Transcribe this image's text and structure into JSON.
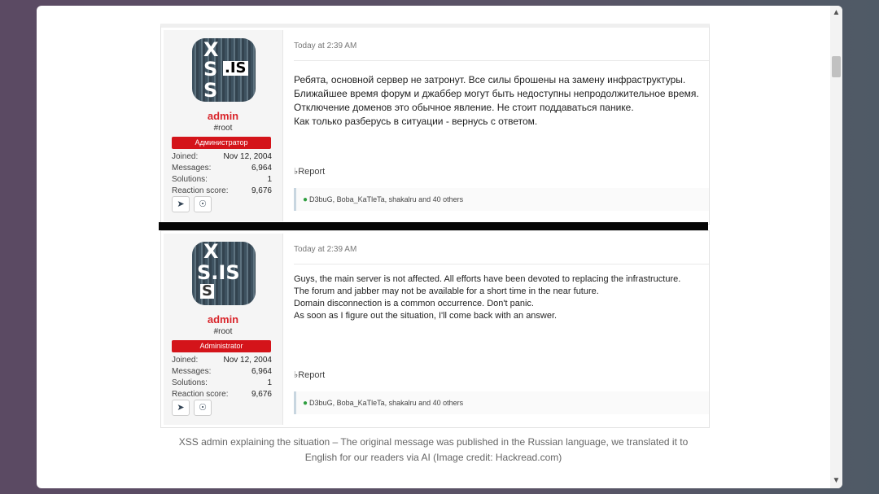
{
  "posts": [
    {
      "avatar_text": {
        "x": "X",
        "s1": "S",
        "is": ".IS",
        "s2": "S"
      },
      "username": "admin",
      "user_title": "#root",
      "role": "Администратор",
      "stats": [
        {
          "label": "Joined:",
          "value": "Nov 12, 2004"
        },
        {
          "label": "Messages:",
          "value": "6,964"
        },
        {
          "label": "Solutions:",
          "value": "1"
        },
        {
          "label": "Reaction score:",
          "value": "9,676"
        }
      ],
      "timestamp": "Today at 2:39 AM",
      "lines": [
        "Ребята, основной сервер не затронут. Все силы брошены на замену инфраструктуры.",
        "Ближайшее время форум и джаббер могут быть недоступны непродолжительное время.",
        "Отключение доменов это обычное явление. Не стоит поддаваться панике.",
        "Как только разберусь в ситуации - вернусь с ответом."
      ],
      "report_label": "Report",
      "reactions_text": "D3buG, Boba_KaTleTa, shakalru and 40 others"
    },
    {
      "avatar_text": {
        "x": "X",
        "sis": "S.IS",
        "s3": "S"
      },
      "username": "admin",
      "user_title": "#root",
      "role": "Administrator",
      "stats": [
        {
          "label": "Joined:",
          "value": "Nov 12, 2004"
        },
        {
          "label": "Messages:",
          "value": "6,964"
        },
        {
          "label": "Solutions:",
          "value": "1"
        },
        {
          "label": "Reaction score:",
          "value": "9,676"
        }
      ],
      "timestamp": "Today at 2:39 AM",
      "lines": [
        "Guys, the main server is not affected. All efforts have been devoted to replacing the infrastructure.",
        "The forum and jabber may not be available for a short time in the near future.",
        "Domain disconnection is a common occurrence. Don't panic.",
        "As soon as I figure out the situation, I'll come back with an answer."
      ],
      "report_label": "Report",
      "reactions_text": "D3buG, Boba_KaTleTa, shakalru and 40 others"
    }
  ],
  "caption_line1": "XSS admin explaining the situation – The original message was published in the Russian language, we translated it to",
  "caption_line2": "English for our readers via AI (Image credit: Hackread.com)",
  "icons": {
    "telegram": "telegram-icon",
    "bulb": "lightbulb-icon",
    "bell": "bell-icon",
    "like": "like-icon"
  },
  "colors": {
    "username": "#d9262c",
    "role_badge": "#d4141a",
    "reaction_icon": "#2e9e3f"
  }
}
